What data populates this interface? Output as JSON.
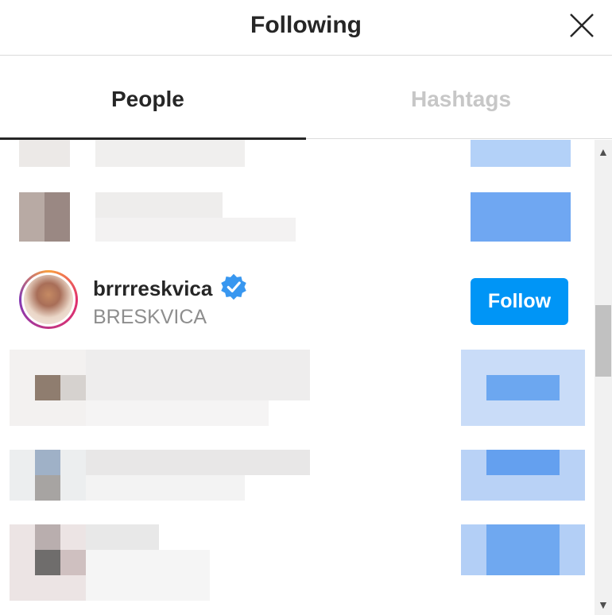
{
  "header": {
    "title": "Following",
    "close_icon": "close-icon"
  },
  "tabs": [
    {
      "label": "People",
      "active": true
    },
    {
      "label": "Hashtags",
      "active": false
    }
  ],
  "featured_user": {
    "username": "brrrreskvica",
    "full_name": "BRESKVICA",
    "verified": true,
    "button_label": "Follow"
  },
  "colors": {
    "primary_button": "#0095f6",
    "verified_badge": "#3897f0",
    "text_primary": "#262626",
    "text_secondary": "#8e8e8e",
    "inactive_tab": "#c7c7c7"
  }
}
